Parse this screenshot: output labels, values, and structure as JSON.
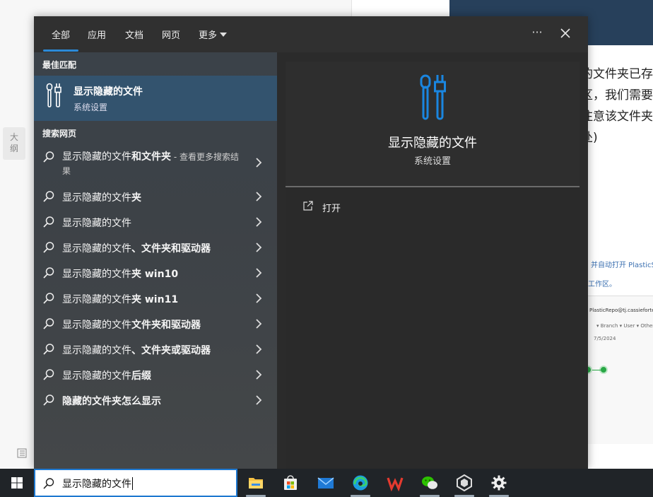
{
  "background_app": {
    "outline_tab_label": "大纲",
    "doc_lines": [
      "的文件夹已存",
      "区，我们需要",
      "注意该文件夹",
      "处)"
    ],
    "doc_small_1": "并自动打开 PlasticSC",
    "doc_small_2": "工作区。",
    "shot_text_1": "PlasticRepo@tj.cassiefortech@clo",
    "shot_text_2": "▾ Branch ▾  User ▾  Other",
    "shot_text_3": "7/5/2024"
  },
  "search": {
    "tabs": [
      {
        "label": "全部"
      },
      {
        "label": "应用"
      },
      {
        "label": "文档"
      },
      {
        "label": "网页"
      },
      {
        "label": "更多"
      }
    ],
    "more_options_label": "···",
    "best_match": {
      "heading": "最佳匹配",
      "title": "显示隐藏的文件",
      "subtitle": "系统设置",
      "icon": "settings-tools-icon"
    },
    "search_web": {
      "heading": "搜索网页",
      "items": [
        {
          "prefix": "显示隐藏的文件",
          "bold": "和文件夹",
          "extra": " - 查看更多搜索结果"
        },
        {
          "prefix": "显示隐藏的文件",
          "bold": "夹",
          "extra": ""
        },
        {
          "prefix": "显示隐藏的文件",
          "bold": "",
          "extra": ""
        },
        {
          "prefix": "显示隐藏的文件",
          "bold": "、文件夹和驱动器",
          "extra": ""
        },
        {
          "prefix": "显示隐藏的文件",
          "bold": "夹 win10",
          "extra": ""
        },
        {
          "prefix": "显示隐藏的文件",
          "bold": "夹 win11",
          "extra": ""
        },
        {
          "prefix": "显示隐藏的文件",
          "bold": "文件夹和驱动器",
          "extra": ""
        },
        {
          "prefix": "显示隐藏的文件",
          "bold": "、文件夹或驱动器",
          "extra": ""
        },
        {
          "prefix": "显示隐藏的文件",
          "bold": "后缀",
          "extra": ""
        },
        {
          "prefix": "",
          "bold": "隐藏的文件夹怎么显示",
          "extra": ""
        }
      ]
    },
    "detail": {
      "title": "显示隐藏的文件",
      "subtitle": "系统设置",
      "open_label": "打开"
    }
  },
  "taskbar": {
    "search_value": "显示隐藏的文件",
    "apps": [
      {
        "name": "file-explorer-icon"
      },
      {
        "name": "microsoft-store-icon"
      },
      {
        "name": "mail-icon"
      },
      {
        "name": "edge-icon"
      },
      {
        "name": "wps-icon"
      },
      {
        "name": "wechat-icon"
      },
      {
        "name": "unity-icon"
      },
      {
        "name": "settings-gear-icon"
      }
    ]
  },
  "colors": {
    "accent": "#2b8ad8",
    "best_match_bg": "#33536e",
    "taskbar_bg": "#202428"
  }
}
